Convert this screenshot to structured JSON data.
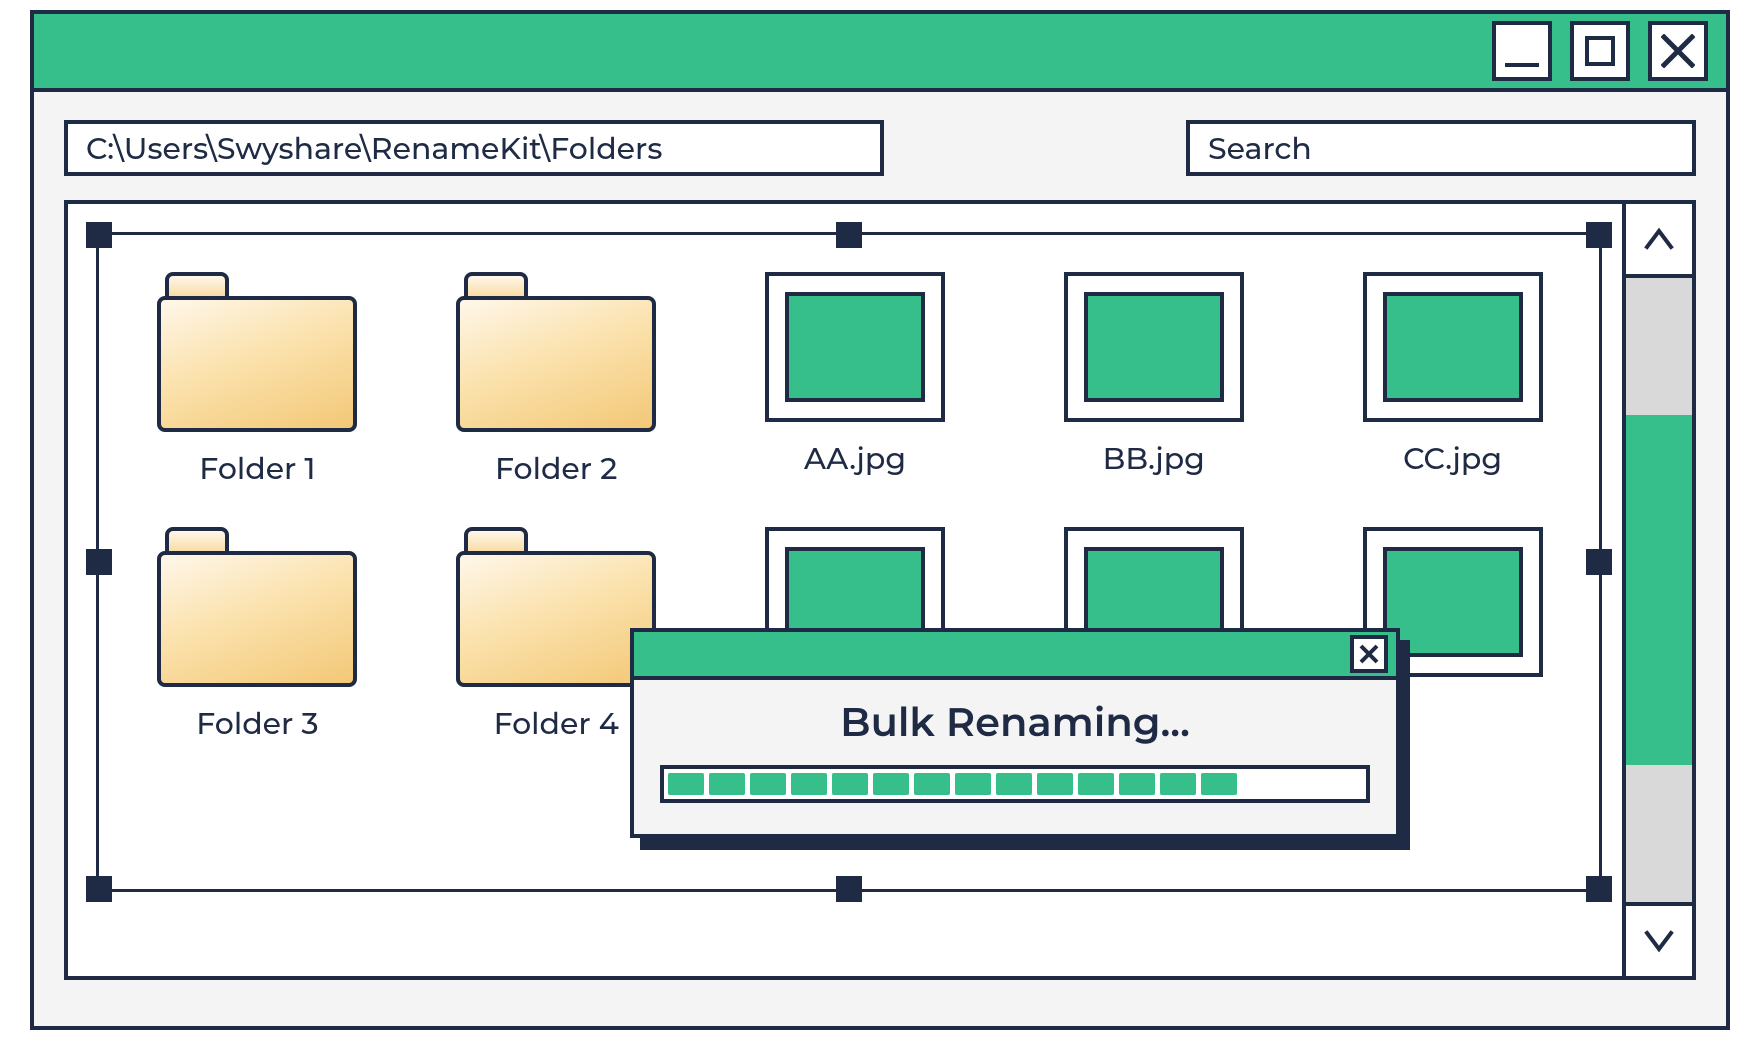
{
  "colors": {
    "accent": "#36bf8a",
    "ink": "#1f2a44",
    "panel": "#f4f4f4"
  },
  "toolbar": {
    "path": "C:\\Users\\Swyshare\\RenameKit\\Folders",
    "search_placeholder": "Search"
  },
  "items": [
    {
      "type": "folder",
      "label": "Folder 1"
    },
    {
      "type": "folder",
      "label": "Folder 2"
    },
    {
      "type": "image",
      "label": "AA.jpg"
    },
    {
      "type": "image",
      "label": "BB.jpg"
    },
    {
      "type": "image",
      "label": "CC.jpg"
    },
    {
      "type": "folder",
      "label": "Folder 3"
    },
    {
      "type": "folder",
      "label": "Folder 4"
    },
    {
      "type": "image",
      "label": ""
    },
    {
      "type": "image",
      "label": ""
    },
    {
      "type": "image",
      "label": ""
    }
  ],
  "dialog": {
    "title": "Bulk Renaming...",
    "progress_segments": 14
  }
}
